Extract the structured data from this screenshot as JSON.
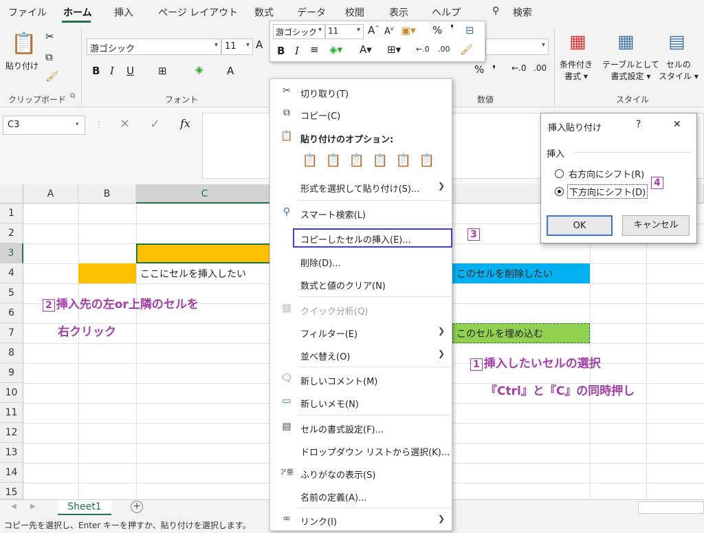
{
  "tabs": [
    "ファイル",
    "ホーム",
    "挿入",
    "ページ レイアウト",
    "数式",
    "データ",
    "校閲",
    "表示",
    "ヘルプ",
    "検索"
  ],
  "ribbon": {
    "paste_label": "貼り付け",
    "clipboard_group": "クリップボード",
    "font_name": "游ゴシック",
    "font_size": "11",
    "font_group": "フォント",
    "number_group": "数値",
    "style_group": "スタイル",
    "cond_format": "条件付き\n書式 ▾",
    "table_format": "テーブルとして\n書式設定 ▾",
    "cell_style": "セルの\nスタイル ▾",
    "bold": "B",
    "italic": "I",
    "underline": "U",
    "percent": "%"
  },
  "namebox": "C3",
  "fx": "fx",
  "mini_toolbar": {
    "font_name": "游ゴシック",
    "font_size": "11",
    "bold": "B",
    "italic": "I",
    "percent": "%"
  },
  "columns": [
    "A",
    "B",
    "C"
  ],
  "rows": [
    "1",
    "2",
    "3",
    "4",
    "5",
    "6",
    "7",
    "8",
    "9",
    "10",
    "11",
    "12",
    "13",
    "14",
    "15"
  ],
  "cells": {
    "c4": "ここにセルを挿入したい",
    "e4": "このセルを削除したい",
    "e7": "このセルを埋め込む"
  },
  "annotations": {
    "a2_num": "2",
    "a2_line1": "挿入先の左or上隣のセルを",
    "a2_line2": "右クリック",
    "a1_num": "1",
    "a1_line1": "挿入したいセルの選択",
    "a1_line2": "『Ctrl』と『C』の同時押し",
    "a3_num": "3",
    "a4_num": "4"
  },
  "context_menu": {
    "cut": "切り取り(T)",
    "copy": "コピー(C)",
    "paste_options": "貼り付けのオプション:",
    "paste_special": "形式を選択して貼り付け(S)...",
    "smart_lookup": "スマート検索(L)",
    "insert_copied": "コピーしたセルの挿入(E)...",
    "delete": "削除(D)...",
    "clear": "数式と値のクリア(N)",
    "quick_analysis": "クイック分析(Q)",
    "filter": "フィルター(E)",
    "sort": "並べ替え(O)",
    "new_comment": "新しいコメント(M)",
    "new_note": "新しいメモ(N)",
    "format_cells": "セルの書式設定(F)...",
    "pick_list": "ドロップダウン リストから選択(K)...",
    "phonetic": "ふりがなの表示(S)",
    "define_name": "名前の定義(A)...",
    "link": "リンク(I)"
  },
  "dialog": {
    "title": "挿入貼り付け",
    "help": "?",
    "close": "✕",
    "group": "挿入",
    "opt_right": "右方向にシフト(R)",
    "opt_down": "下方向にシフト(D)",
    "ok": "OK",
    "cancel": "キャンセル"
  },
  "sheet_tab": "Sheet1",
  "status": "コピー先を選択し、Enter キーを押すか、貼り付けを選択します。",
  "colors": {
    "accent": "#217346",
    "orange": "#ffc000",
    "blue": "#00b0f0",
    "green": "#92d050",
    "annotation": "#a23fa8",
    "highlight_box": "#4040c0"
  }
}
